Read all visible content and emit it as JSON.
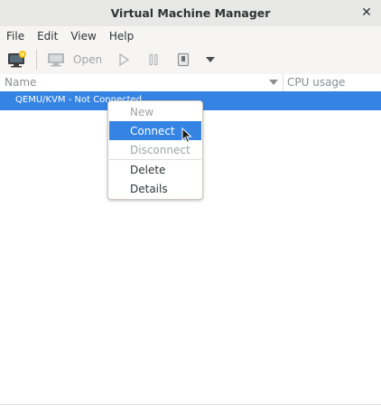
{
  "window": {
    "title": "Virtual Machine Manager"
  },
  "menubar": {
    "items": [
      "File",
      "Edit",
      "View",
      "Help"
    ]
  },
  "toolbar": {
    "open_label": "Open"
  },
  "columns": {
    "name": "Name",
    "cpu": "CPU usage"
  },
  "connection_row": {
    "label": "QEMU/KVM - Not Connected"
  },
  "context_menu": {
    "items": [
      {
        "label": "New",
        "enabled": false
      },
      {
        "label": "Connect",
        "enabled": true,
        "highlighted": true
      },
      {
        "label": "Disconnect",
        "enabled": false
      },
      {
        "label": "Delete",
        "enabled": true
      },
      {
        "label": "Details",
        "enabled": true
      }
    ]
  },
  "colors": {
    "accent": "#3584e4",
    "disabled_text": "#a0a3a5"
  }
}
